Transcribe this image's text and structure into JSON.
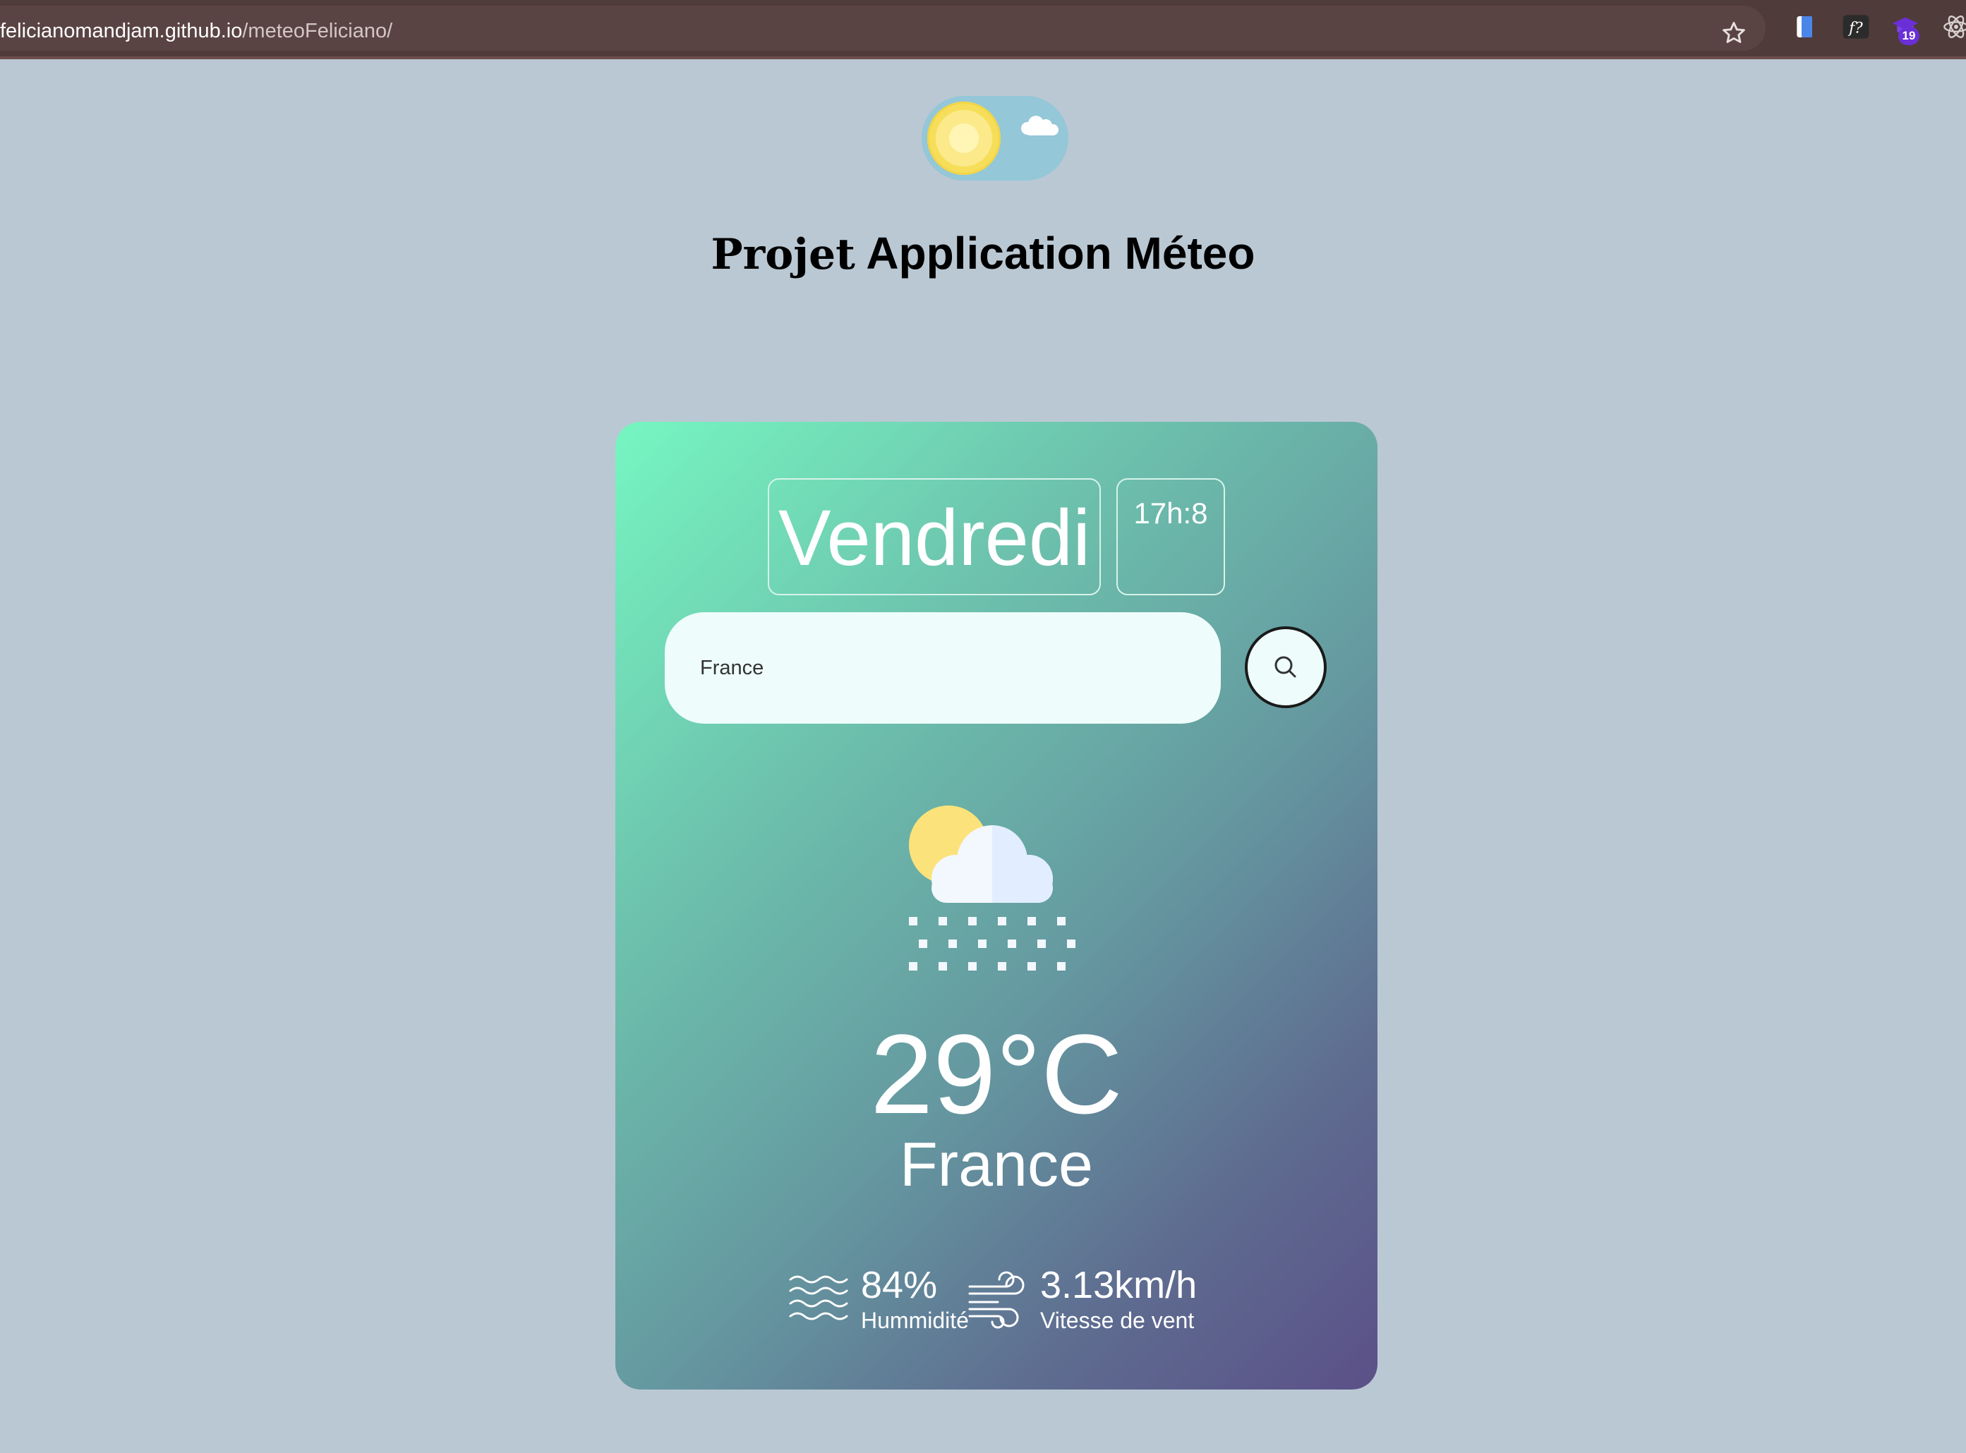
{
  "browser": {
    "url_host": "felicianomandjam.github.io",
    "url_path": "/meteoFeliciano/",
    "extension_badge": "19"
  },
  "header": {
    "title_part1": "Projet",
    "title_part2": "Application Méteo"
  },
  "card": {
    "day": "Vendredi",
    "time": "17h:8",
    "search_value": "France",
    "temperature": "29°C",
    "city": "France",
    "weather_icon": "sun-cloud-snow-icon",
    "humidity_value": "84%",
    "humidity_label": "Hummidité",
    "wind_value": "3.13km/h",
    "wind_label": "Vitesse de vent"
  },
  "colors": {
    "page_background": "#bac8d3",
    "card_gradient_start": "#76f6c1",
    "card_gradient_end": "#5b5088",
    "browser_bar": "#4f3b3a"
  }
}
